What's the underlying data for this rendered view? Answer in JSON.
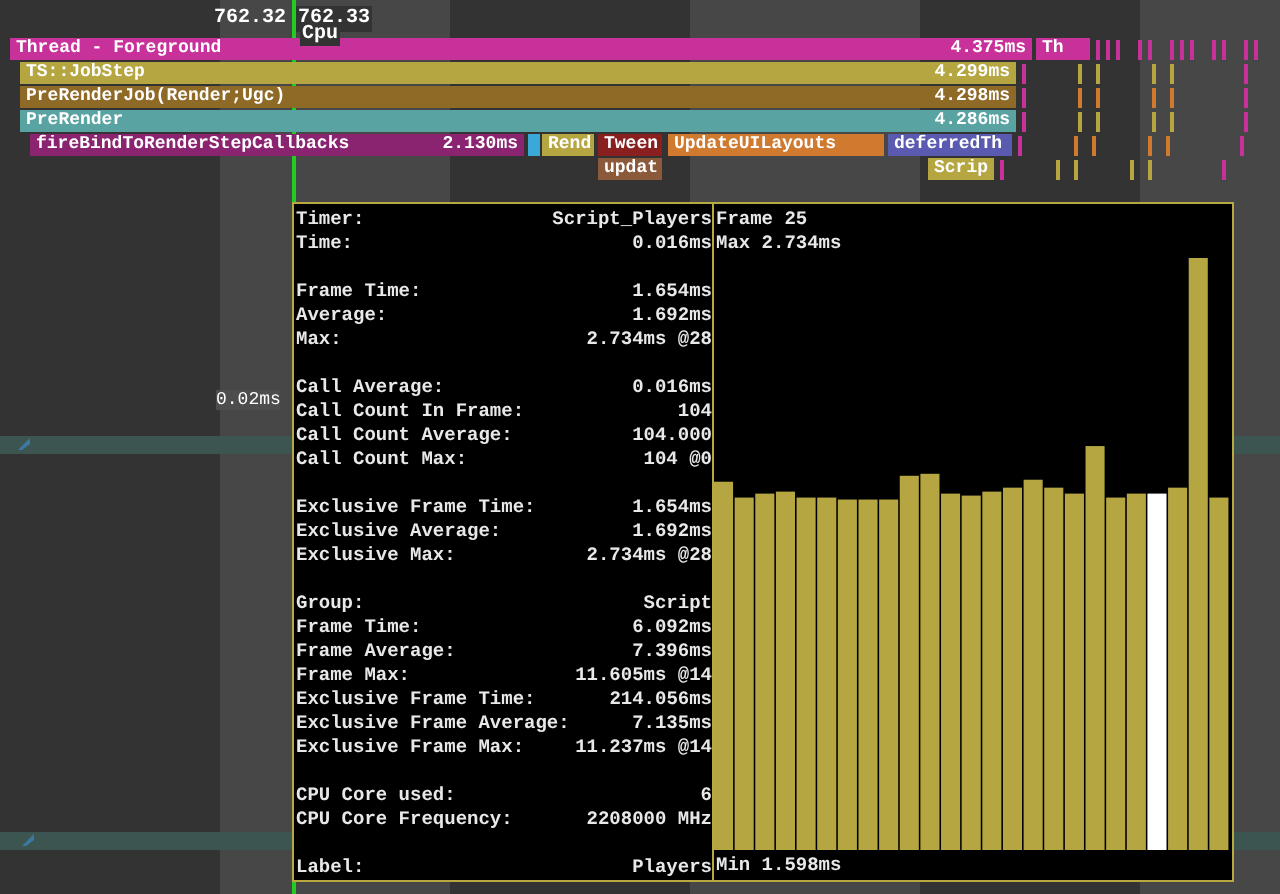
{
  "timeline": {
    "ticks": [
      "762.32",
      "762.33"
    ],
    "cursor_label": "Cpu",
    "span_label": "0.02ms"
  },
  "rows": [
    [
      {
        "name": "Thread - Foreground",
        "time": "4.375ms",
        "color": "#c8309a"
      },
      {
        "name": "Th",
        "color": "#c8309a"
      }
    ],
    [
      {
        "name": "TS::JobStep",
        "time": "4.299ms",
        "color": "#b5a642"
      }
    ],
    [
      {
        "name": "PreRenderJob(Render;Ugc)",
        "time": "4.298ms",
        "color": "#8f6a26"
      }
    ],
    [
      {
        "name": "PreRender",
        "time": "4.286ms",
        "color": "#5aa3a3"
      }
    ],
    [
      {
        "name": "fireBindToRenderStepCallbacks",
        "time": "2.130ms",
        "color": "#8a2370"
      },
      {
        "color": "#3aa8d8"
      },
      {
        "name": "Rend",
        "color": "#b5a642"
      },
      {
        "name": "Tween",
        "color": "#8a1f1f"
      },
      {
        "name": "UpdateUILayouts",
        "color": "#d07a30"
      },
      {
        "name": "deferredTh",
        "color": "#5a5ab0"
      }
    ],
    [
      {
        "name": "updat",
        "color": "#8a5a3a"
      },
      {
        "name": "Scrip",
        "color": "#b5a642"
      }
    ]
  ],
  "tooltip": {
    "sections": [
      [
        {
          "label": "Timer:",
          "value": "Script_Players"
        },
        {
          "label": "Time:",
          "value": "0.016ms"
        }
      ],
      [
        {
          "label": "Frame Time:",
          "value": "1.654ms"
        },
        {
          "label": "Average:",
          "value": "1.692ms"
        },
        {
          "label": "Max:",
          "value": "2.734ms @28"
        }
      ],
      [
        {
          "label": "Call Average:",
          "value": "0.016ms"
        },
        {
          "label": "Call Count In Frame:",
          "value": "104"
        },
        {
          "label": "Call Count Average:",
          "value": "104.000"
        },
        {
          "label": "Call Count Max:",
          "value": "104 @0"
        }
      ],
      [
        {
          "label": "Exclusive Frame Time:",
          "value": "1.654ms"
        },
        {
          "label": "Exclusive Average:",
          "value": "1.692ms"
        },
        {
          "label": "Exclusive Max:",
          "value": "2.734ms @28"
        }
      ],
      [
        {
          "label": "Group:",
          "value": "Script"
        },
        {
          "label": "Frame Time:",
          "value": "6.092ms"
        },
        {
          "label": "Frame Average:",
          "value": "7.396ms"
        },
        {
          "label": "Frame Max:",
          "value": "11.605ms @14"
        },
        {
          "label": "Exclusive Frame Time:",
          "value": "214.056ms"
        },
        {
          "label": "Exclusive Frame Average:",
          "value": "7.135ms"
        },
        {
          "label": "Exclusive Frame Max:",
          "value": "11.237ms @14"
        }
      ],
      [
        {
          "label": "CPU Core used:",
          "value": "6"
        },
        {
          "label": "CPU Core Frequency:",
          "value": "2208000 MHz"
        }
      ],
      [
        {
          "label": "Label:",
          "value": "Players"
        }
      ]
    ],
    "frame_title": "Frame 25",
    "max_label": "Max 2.734ms",
    "min_label": "Min 1.598ms"
  }
}
